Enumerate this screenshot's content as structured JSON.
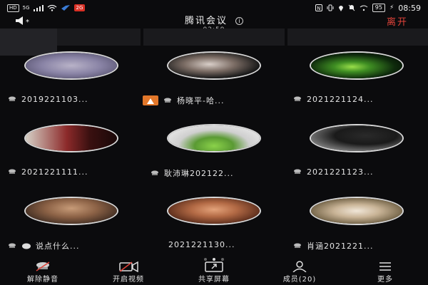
{
  "status_bar": {
    "hd_label": "HD",
    "network_label": "5G",
    "badge_label": "2G",
    "battery_label": "95",
    "time": "08:59"
  },
  "header": {
    "title": "腾讯会议",
    "timer": "02:59",
    "leave_label": "离开"
  },
  "participants": [
    {
      "name": "2019221103...",
      "speaking": false,
      "avatar": "illustration"
    },
    {
      "name": "杨晓平-哈...",
      "speaking": true,
      "avatar": "sunglasses"
    },
    {
      "name": "2021221124...",
      "speaking": false,
      "avatar": "green-glow"
    },
    {
      "name": "2021221111...",
      "speaking": false,
      "avatar": "street-red"
    },
    {
      "name": "耿沛琳202122...",
      "speaking": false,
      "avatar": "green-shirt"
    },
    {
      "name": "2021221123...",
      "speaking": false,
      "avatar": "dark-figure"
    },
    {
      "name": "说点什么...",
      "speaking": false,
      "avatar": "sepia-hat"
    },
    {
      "name": "2021221130...",
      "speaking": false,
      "avatar": "silhouette"
    },
    {
      "name": "肖涵2021221...",
      "speaking": false,
      "avatar": "bright-photo"
    }
  ],
  "pager": {
    "count": 3,
    "active": 1
  },
  "toolbar": {
    "unmute_label": "解除静音",
    "video_label": "开启视频",
    "share_label": "共享屏幕",
    "members_label": "成员(20)",
    "more_label": "更多"
  },
  "colors": {
    "background": "#0b0b0d",
    "leave": "#e0433a",
    "speaking_badge": "#e2772a"
  }
}
